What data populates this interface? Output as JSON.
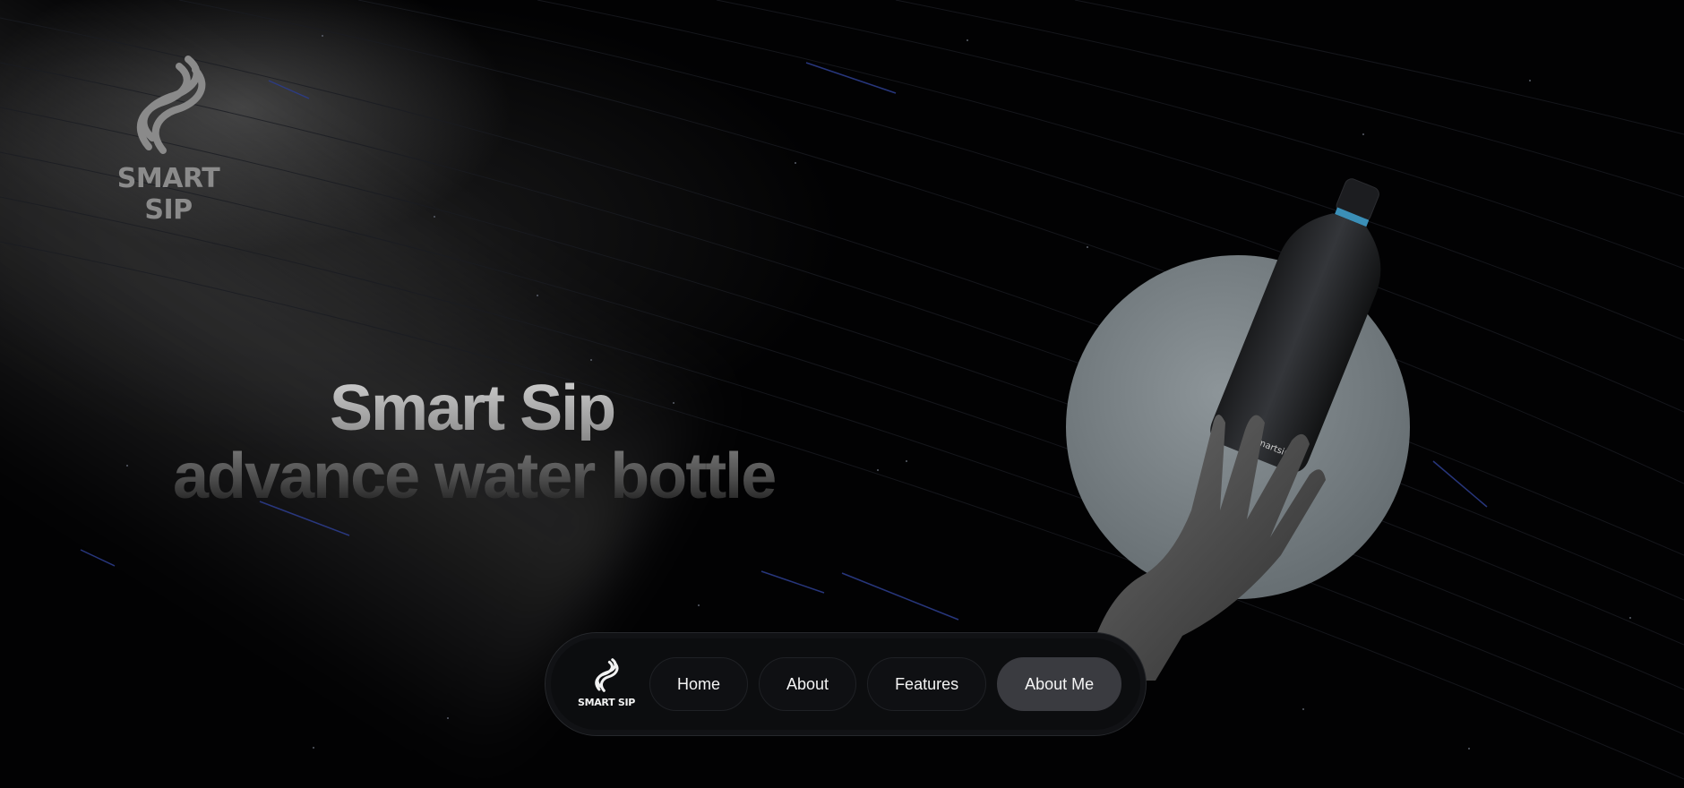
{
  "brand": {
    "name": "SMART SIP",
    "logo_icon": "smart-sip-s-logo"
  },
  "hero": {
    "title": "Smart Sip",
    "subtitle": "advance water bottle"
  },
  "product": {
    "bottle_label": "smartsip",
    "images": [
      "water-bottle",
      "open-hand",
      "grey-disc"
    ]
  },
  "nav": {
    "logo_text": "SMART SIP",
    "items": [
      {
        "label": "Home",
        "active": false
      },
      {
        "label": "About",
        "active": false
      },
      {
        "label": "Features",
        "active": false
      },
      {
        "label": "About Me",
        "active": true
      }
    ]
  },
  "colors": {
    "background": "#020203",
    "nav_background": "#0c0d0f",
    "nav_active": "#3a3b40",
    "disc": "#7d8589",
    "streak_accent": "#3b4a9c"
  }
}
